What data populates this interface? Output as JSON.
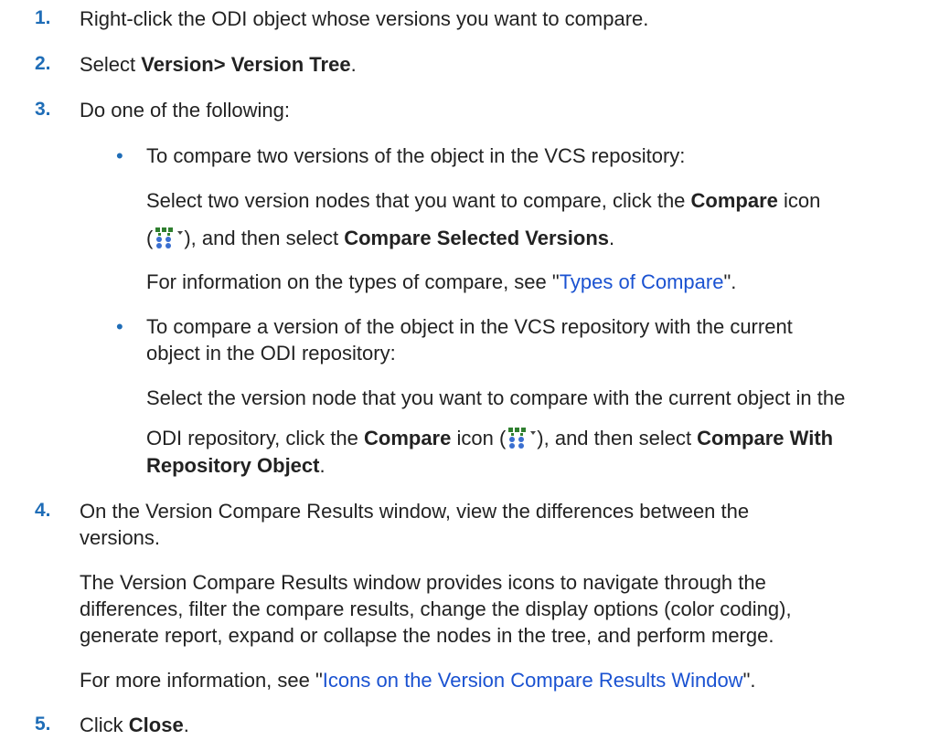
{
  "steps": [
    {
      "num": "1.",
      "text": "Right-click the ODI object whose versions you want to compare."
    },
    {
      "num": "2.",
      "pre": "Select ",
      "bold": "Version> Version Tree",
      "post": "."
    },
    {
      "num": "3.",
      "text": "Do one of the following:"
    },
    {
      "num": "4.",
      "line1": "On the Version Compare Results window, view the differences between the",
      "line2": "versions."
    },
    {
      "num": "5.",
      "pre": "Click ",
      "bold": "Close",
      "post": "."
    }
  ],
  "bullet1": {
    "text": "To compare two versions of the object in the VCS repository:",
    "p1_pre": "Select two version nodes that you want to compare, click the ",
    "p1_bold": "Compare",
    "p1_post": " icon",
    "p2_open": "(",
    "p2_mid": "), and then select ",
    "p2_bold": "Compare Selected Versions",
    "p2_end": ".",
    "p3_pre": "For information on the types of compare, see \"",
    "p3_link": "Types of Compare",
    "p3_post": "\"."
  },
  "bullet2": {
    "line1": "To compare a version of the object in the VCS repository with the current",
    "line2": "object in the ODI repository:",
    "p1": "Select the version node that you want to compare with the current object in the",
    "p2_pre": "ODI repository, click the ",
    "p2_bold": "Compare",
    "p2_mid": " icon (",
    "p2_mid2": "), and then select ",
    "p2_bold2": "Compare With",
    "p3_bold": "Repository Object",
    "p3_end": "."
  },
  "step4_detail": {
    "l1": "The Version Compare Results window provides icons to navigate through the",
    "l2": "differences, filter the compare results, change the display options (color coding),",
    "l3": "generate report, expand or collapse the nodes in the tree, and perform merge.",
    "more_pre": "For more information, see \"",
    "more_link": "Icons on the Version Compare Results Window",
    "more_post": "\"."
  },
  "bullet_glyph": "•",
  "icons": [
    "compare-icon"
  ]
}
